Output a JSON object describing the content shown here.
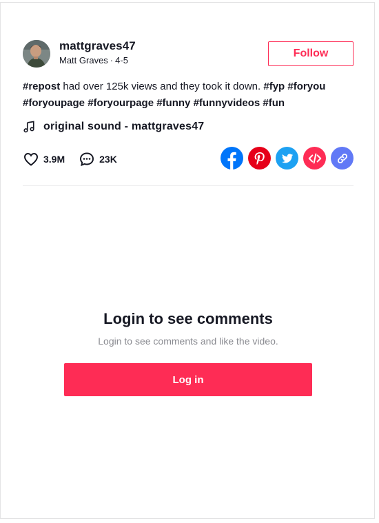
{
  "author": {
    "username": "mattgraves47",
    "display_name": "Matt Graves",
    "date": "4-5"
  },
  "follow_label": "Follow",
  "caption": [
    {
      "text": "#repost",
      "tag": true
    },
    {
      "text": " had over 125k views and they took it down. ",
      "tag": false
    },
    {
      "text": "#fyp",
      "tag": true
    },
    {
      "text": " ",
      "tag": false
    },
    {
      "text": "#foryou",
      "tag": true
    },
    {
      "text": " ",
      "tag": false
    },
    {
      "text": "#foryoupage",
      "tag": true
    },
    {
      "text": " ",
      "tag": false
    },
    {
      "text": "#foryourpage",
      "tag": true
    },
    {
      "text": " ",
      "tag": false
    },
    {
      "text": "#funny",
      "tag": true
    },
    {
      "text": " ",
      "tag": false
    },
    {
      "text": "#funnyvideos",
      "tag": true
    },
    {
      "text": " ",
      "tag": false
    },
    {
      "text": "#fun",
      "tag": true
    }
  ],
  "sound": {
    "label": "original sound - mattgraves47",
    "icon": "music-note-icon"
  },
  "stats": {
    "likes": "3.9M",
    "comments": "23K"
  },
  "share": [
    {
      "name": "facebook",
      "icon": "facebook-icon",
      "color": "#0075fa"
    },
    {
      "name": "pinterest",
      "icon": "pinterest-icon",
      "color": "#e60019"
    },
    {
      "name": "twitter",
      "icon": "twitter-icon",
      "color": "#1da1f2"
    },
    {
      "name": "embed",
      "icon": "embed-code-icon",
      "color": "#fe2c55"
    },
    {
      "name": "copy-link",
      "icon": "link-icon",
      "color": "#6179f6"
    }
  ],
  "login": {
    "title": "Login to see comments",
    "subtitle": "Login to see comments and like the video.",
    "button": "Log in"
  },
  "colors": {
    "accent": "#fe2c55",
    "text": "#161823",
    "muted": "#8a8b91"
  }
}
